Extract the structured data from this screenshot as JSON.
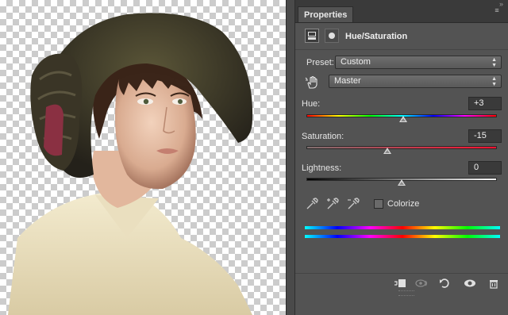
{
  "canvas": {
    "description_icon": "woman-portrait-photo"
  },
  "panel": {
    "tab_label": "Properties",
    "adjustment_title": "Hue/Saturation",
    "preset_label": "Preset:",
    "preset_value": "Custom",
    "channel_value": "Master",
    "hue": {
      "label": "Hue:",
      "value": "+3",
      "level": 3,
      "range": [
        -180,
        180
      ]
    },
    "saturation": {
      "label": "Saturation:",
      "value": "-15",
      "level": -15,
      "range": [
        -100,
        100
      ]
    },
    "lightness": {
      "label": "Lightness:",
      "value": "0",
      "level": 0,
      "range": [
        -100,
        100
      ]
    },
    "colorize_label": "Colorize",
    "colorize_checked": false
  },
  "colors": {
    "panel_bg": "#535353",
    "tabbar_bg": "#3a3a3a",
    "field_bg": "#3a3a3a"
  },
  "icons": [
    "panel-menu-icon",
    "hue-sat-layer-icon",
    "mask-icon",
    "on-image-adjust-icon",
    "eyedropper-icon",
    "eyedropper-plus-icon",
    "eyedropper-minus-icon",
    "clip-to-layer-icon",
    "view-previous-icon",
    "reset-icon",
    "visibility-eye-icon",
    "trash-icon"
  ]
}
